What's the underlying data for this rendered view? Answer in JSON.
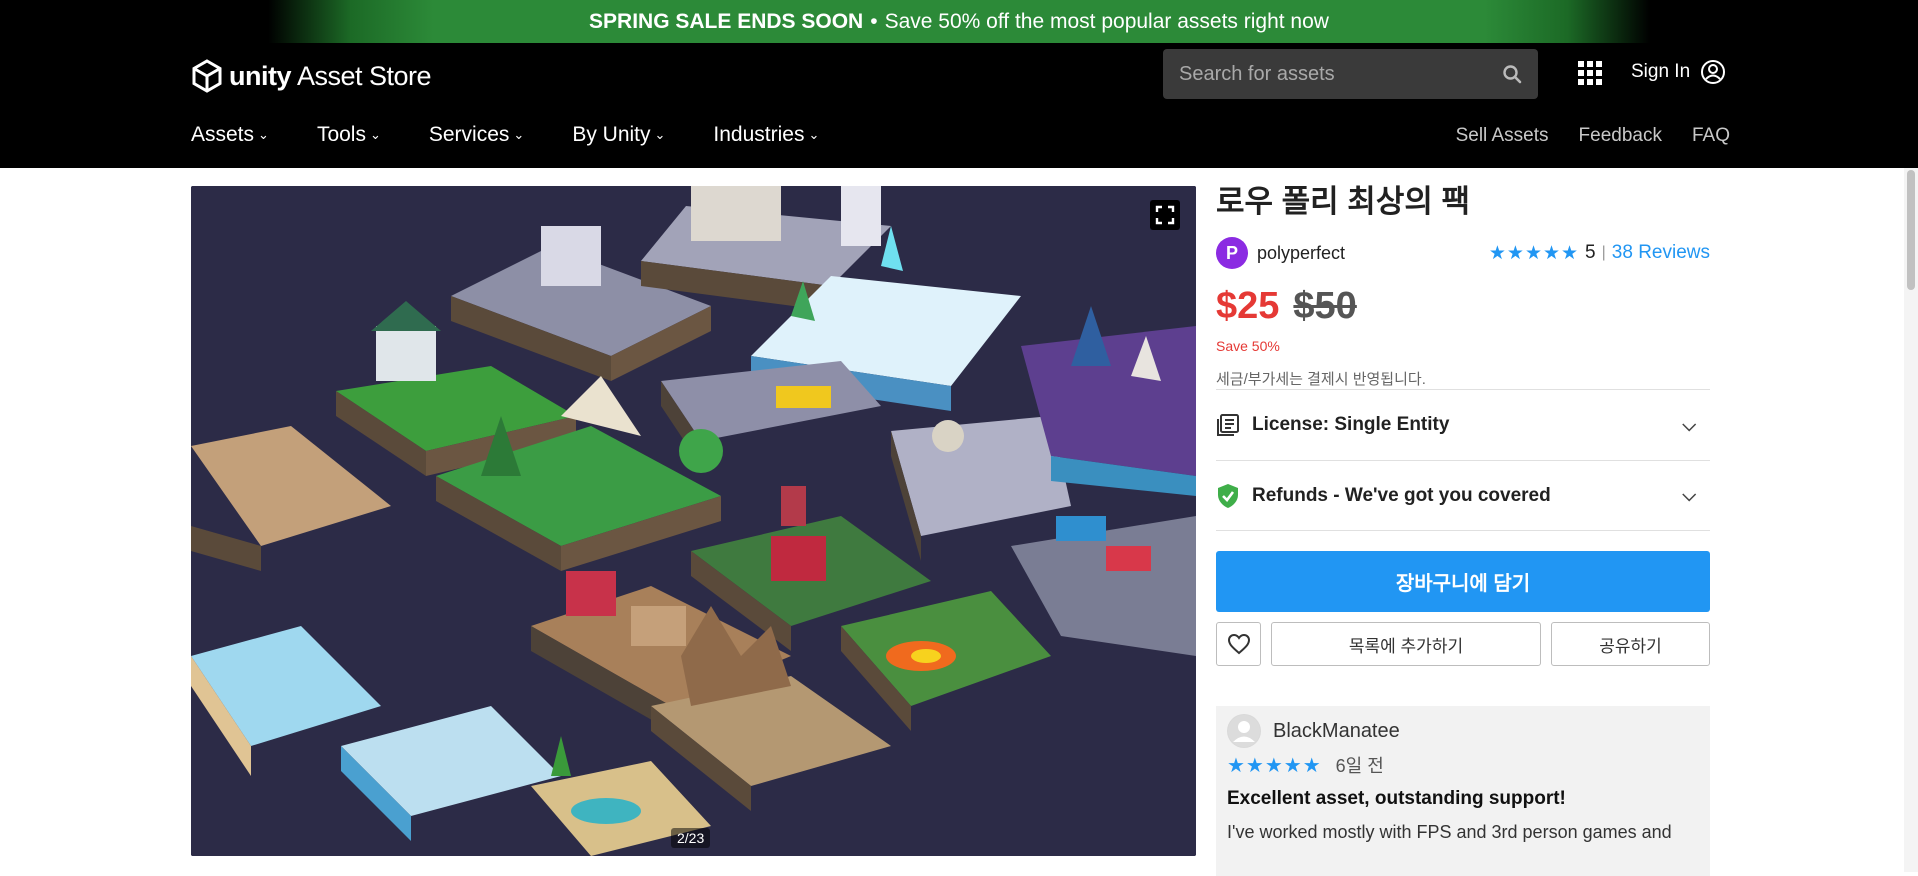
{
  "promo": {
    "bold": "SPRING SALE ENDS SOON",
    "separator": "•",
    "text": "Save 50% off the most popular assets right now"
  },
  "header": {
    "logo_unity": "unity",
    "logo_store": "Asset Store",
    "search_placeholder": "Search for assets",
    "sign_in": "Sign In",
    "nav": [
      "Assets",
      "Tools",
      "Services",
      "By Unity",
      "Industries"
    ],
    "nav_right": [
      "Sell Assets",
      "Feedback",
      "FAQ"
    ]
  },
  "gallery": {
    "counter": "2/23"
  },
  "product": {
    "title": "로우 폴리 최상의 팩",
    "publisher": "polyperfect",
    "stars": "★★★★★",
    "rating": "5",
    "rating_sep": "|",
    "reviews_link": "38 Reviews",
    "price_now": "$25",
    "price_was": "$50",
    "save": "Save 50%",
    "tax": "세금/부가세는 결제시 반영됩니다.",
    "license": "License: Single Entity",
    "refunds": "Refunds - We've got you covered",
    "cart_button": "장바구니에 담기",
    "wishlist_button": "목록에 추가하기",
    "share_button": "공유하기"
  },
  "review": {
    "author": "BlackManatee",
    "stars": "★★★★★",
    "date": "6일 전",
    "title": "Excellent asset, outstanding support!",
    "body": "I've worked mostly with FPS and 3rd person games and"
  },
  "colors": {
    "accent": "#2196f3",
    "sale_red": "#e53935",
    "promo_green": "#2c8a38",
    "publisher_purple": "#8b2be2"
  }
}
